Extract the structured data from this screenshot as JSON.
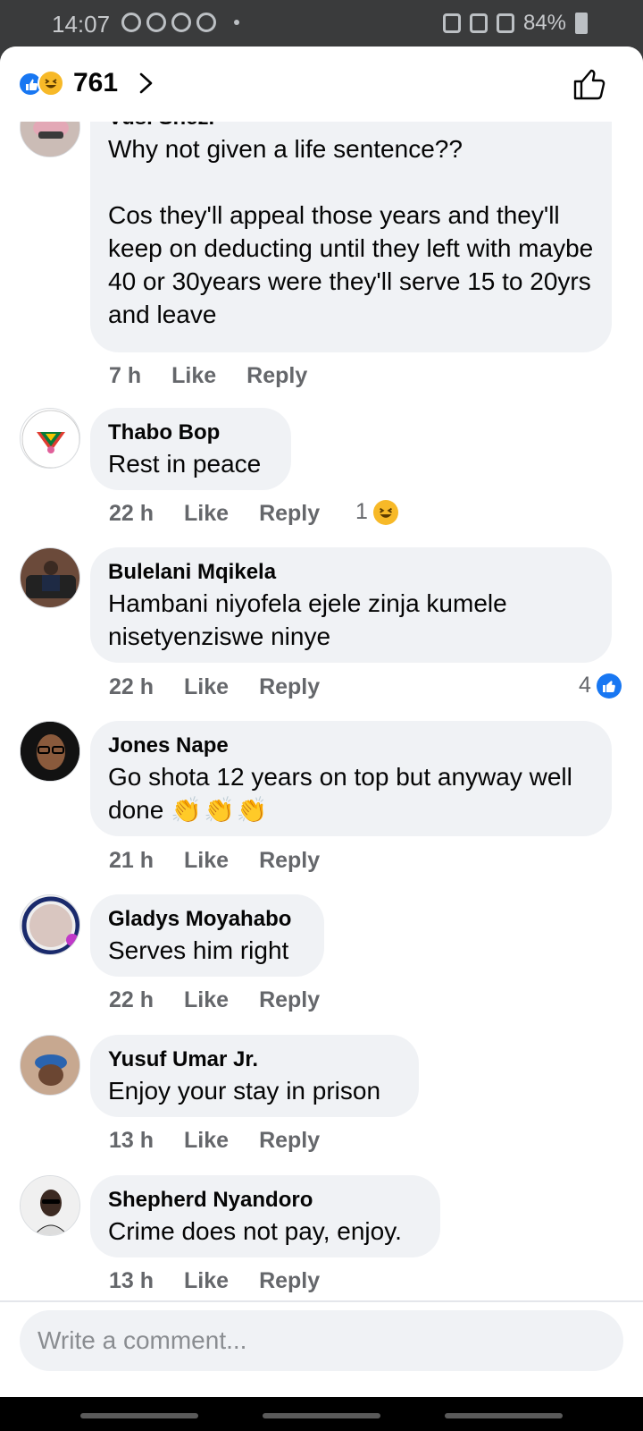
{
  "status_bar": {
    "time": "14:07",
    "battery": "84%"
  },
  "reactions": {
    "count": "761",
    "icons": [
      "like-icon",
      "haha-icon"
    ]
  },
  "comments": [
    {
      "name": "Vusi Shezi",
      "text": "Why not given a life sentence??\n\nCos they'll appeal those years and they'll keep on deducting until they left with maybe 40 or 30years were they'll serve 15 to 20yrs and leave",
      "time": "7 h",
      "like": "Like",
      "reply": "Reply"
    },
    {
      "name": "Thabo Bop",
      "text": "Rest in peace",
      "time": "22 h",
      "like": "Like",
      "reply": "Reply",
      "reaction_count": "1",
      "reaction_icon": "haha-icon"
    },
    {
      "name": "Bulelani Mqikela",
      "text": "Hambani niyofela ejele zinja kumele nisetyenziswe ninye",
      "time": "22 h",
      "like": "Like",
      "reply": "Reply",
      "reaction_count": "4",
      "reaction_icon": "like-icon"
    },
    {
      "name": "Jones Nape",
      "text": "Go shota 12 years on top but anyway well done",
      "emoji": "👏👏👏",
      "time": "21 h",
      "like": "Like",
      "reply": "Reply"
    },
    {
      "name": "Gladys Moyahabo",
      "text": "Serves him right",
      "time": "22 h",
      "like": "Like",
      "reply": "Reply"
    },
    {
      "name": "Yusuf Umar Jr.",
      "text": "Enjoy your stay in prison",
      "time": "13 h",
      "like": "Like",
      "reply": "Reply"
    },
    {
      "name": "Shepherd Nyandoro",
      "text": "Crime does not pay, enjoy.",
      "time": "13 h",
      "like": "Like",
      "reply": "Reply"
    }
  ],
  "composer": {
    "placeholder": "Write a comment..."
  },
  "colors": {
    "accent": "#1877f2",
    "bubble": "#f0f2f5",
    "meta": "#65676b",
    "haha": "#f7b928"
  }
}
